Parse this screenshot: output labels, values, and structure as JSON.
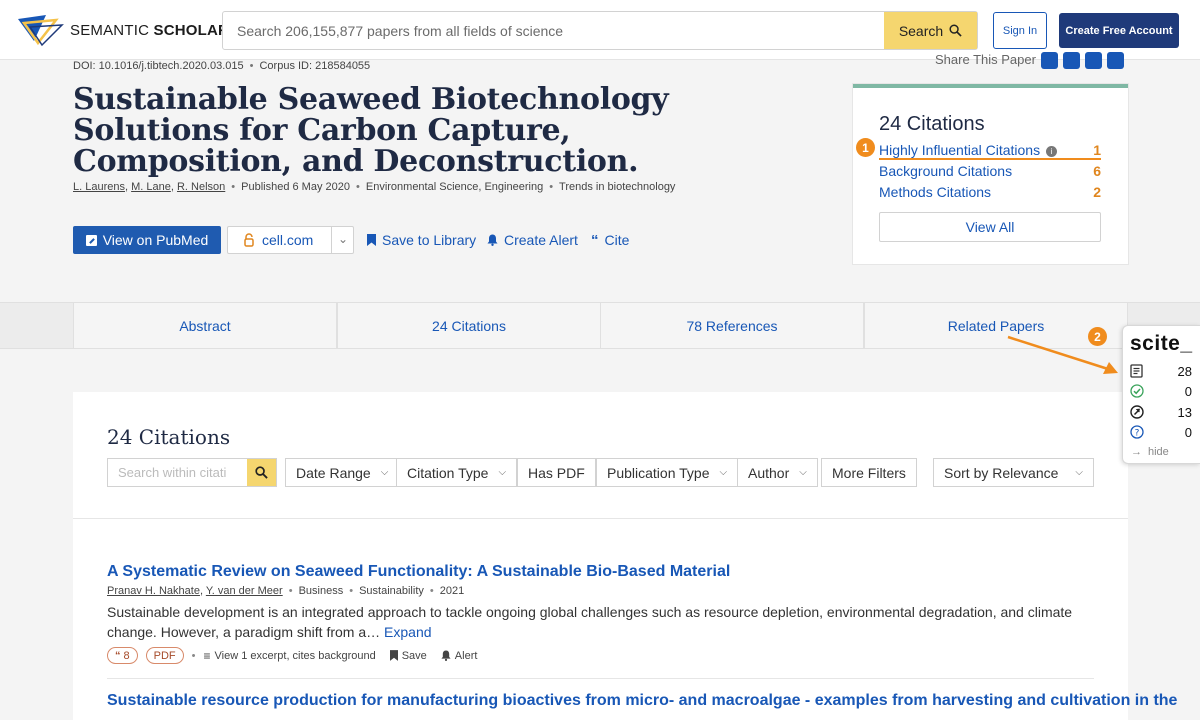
{
  "nav": {
    "logo_light": "SEMANTIC ",
    "logo_bold": "SCHOLAR",
    "search_placeholder": "Search 206,155,877 papers from all fields of science",
    "search_button": "Search",
    "sign_in": "Sign In",
    "create_account": "Create Free Account"
  },
  "paper": {
    "doi": "DOI: 10.1016/j.tibtech.2020.03.015",
    "corpus": "Corpus ID: 218584055",
    "title": "Sustainable Seaweed Biotechnology Solutions for Carbon Capture, Composition, and Deconstruction.",
    "authors": [
      "L. Laurens",
      "M. Lane",
      "R. Nelson"
    ],
    "published": "Published 6 May 2020",
    "fields": "Environmental Science, Engineering",
    "venue": "Trends in biotechnology",
    "share_label": "Share This Paper"
  },
  "actions": {
    "pubmed": "View on PubMed",
    "cell": "cell.com",
    "save": "Save to Library",
    "alert": "Create Alert",
    "cite": "Cite"
  },
  "citations_card": {
    "title": "24 Citations",
    "rows": [
      {
        "label": "Highly Influential Citations",
        "count": "1"
      },
      {
        "label": "Background Citations",
        "count": "6"
      },
      {
        "label": "Methods Citations",
        "count": "2"
      }
    ],
    "view_all": "View All"
  },
  "tabs": [
    "Abstract",
    "24 Citations",
    "78 References",
    "Related Papers"
  ],
  "citations_panel": {
    "heading": "24 Citations",
    "search_placeholder": "Search within citati",
    "filters": [
      "Date Range",
      "Citation Type",
      "Has PDF",
      "Publication Type",
      "Author",
      "More Filters"
    ],
    "sort": "Sort by Relevance"
  },
  "results": [
    {
      "title": "A Systematic Review on Seaweed Functionality: A Sustainable Bio-Based Material",
      "authors": [
        "Pranav H. Nakhate",
        "Y. van der Meer"
      ],
      "field": "Business",
      "venue": "Sustainability",
      "year": "2021",
      "abstract": "Sustainable development is an integrated approach to tackle ongoing global challenges such as resource depletion, environmental degradation, and climate change. However, a paradigm shift from a…",
      "expand": "Expand",
      "cite_count": "8",
      "pdf": "PDF",
      "excerpt": "View 1 excerpt, cites background",
      "save": "Save",
      "alert": "Alert"
    },
    {
      "title": "Sustainable resource production for manufacturing bioactives from micro- and macroalgae - examples from harvesting and cultivation in the"
    }
  ],
  "badges": [
    "1",
    "2"
  ],
  "scite": {
    "brand": "scite_",
    "rows": [
      {
        "icon": "document-icon",
        "count": "28"
      },
      {
        "icon": "supporting-check-icon",
        "count": "0"
      },
      {
        "icon": "contrasting-icon",
        "count": "13"
      },
      {
        "icon": "question-icon",
        "count": "0"
      }
    ],
    "hide": "hide"
  },
  "colors": {
    "accent_blue": "#1857b6",
    "orange": "#f08c1d",
    "search_yellow": "#f5d66f",
    "navy": "#1f3a7a"
  }
}
